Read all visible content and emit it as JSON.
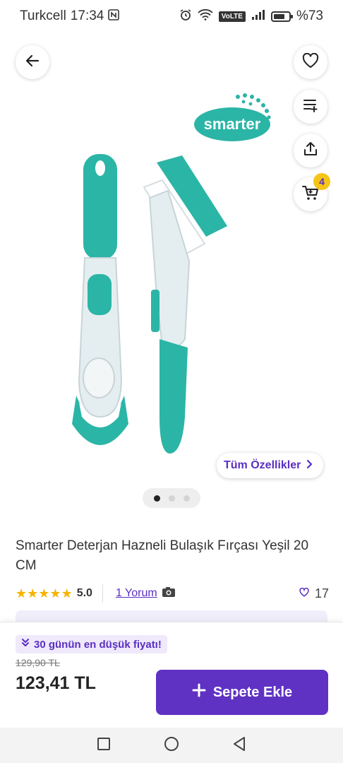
{
  "status_bar": {
    "carrier": "Turkcell",
    "time": "17:34",
    "network_label": "VoLTE",
    "battery_text": "%73",
    "battery_level": 0.73
  },
  "product": {
    "brand_logo": "smarter",
    "title": "Smarter Deterjan Hazneli Bulaşık Fırçası Yeşil 20 CM",
    "features_button": "Tüm Özellikler",
    "image_count": 3,
    "active_image": 1,
    "rating": "5.0",
    "stars": 5,
    "reviews_link": "1 Yorum",
    "likes": "17"
  },
  "header": {
    "cart_badge": "4",
    "icons": [
      "back-arrow-icon",
      "heart-icon",
      "add-to-list-icon",
      "share-icon",
      "cart-icon"
    ]
  },
  "bottom_bar": {
    "low_price_badge": "30 günün en düşük fiyatı!",
    "old_price": "129,90 TL",
    "price": "123,41 TL",
    "add_to_cart": "Sepete Ekle"
  },
  "colors": {
    "brand_purple": "#5f32c4",
    "teal": "#2bb5a6",
    "badge_yellow": "#f5c518",
    "star": "#f5b400"
  }
}
